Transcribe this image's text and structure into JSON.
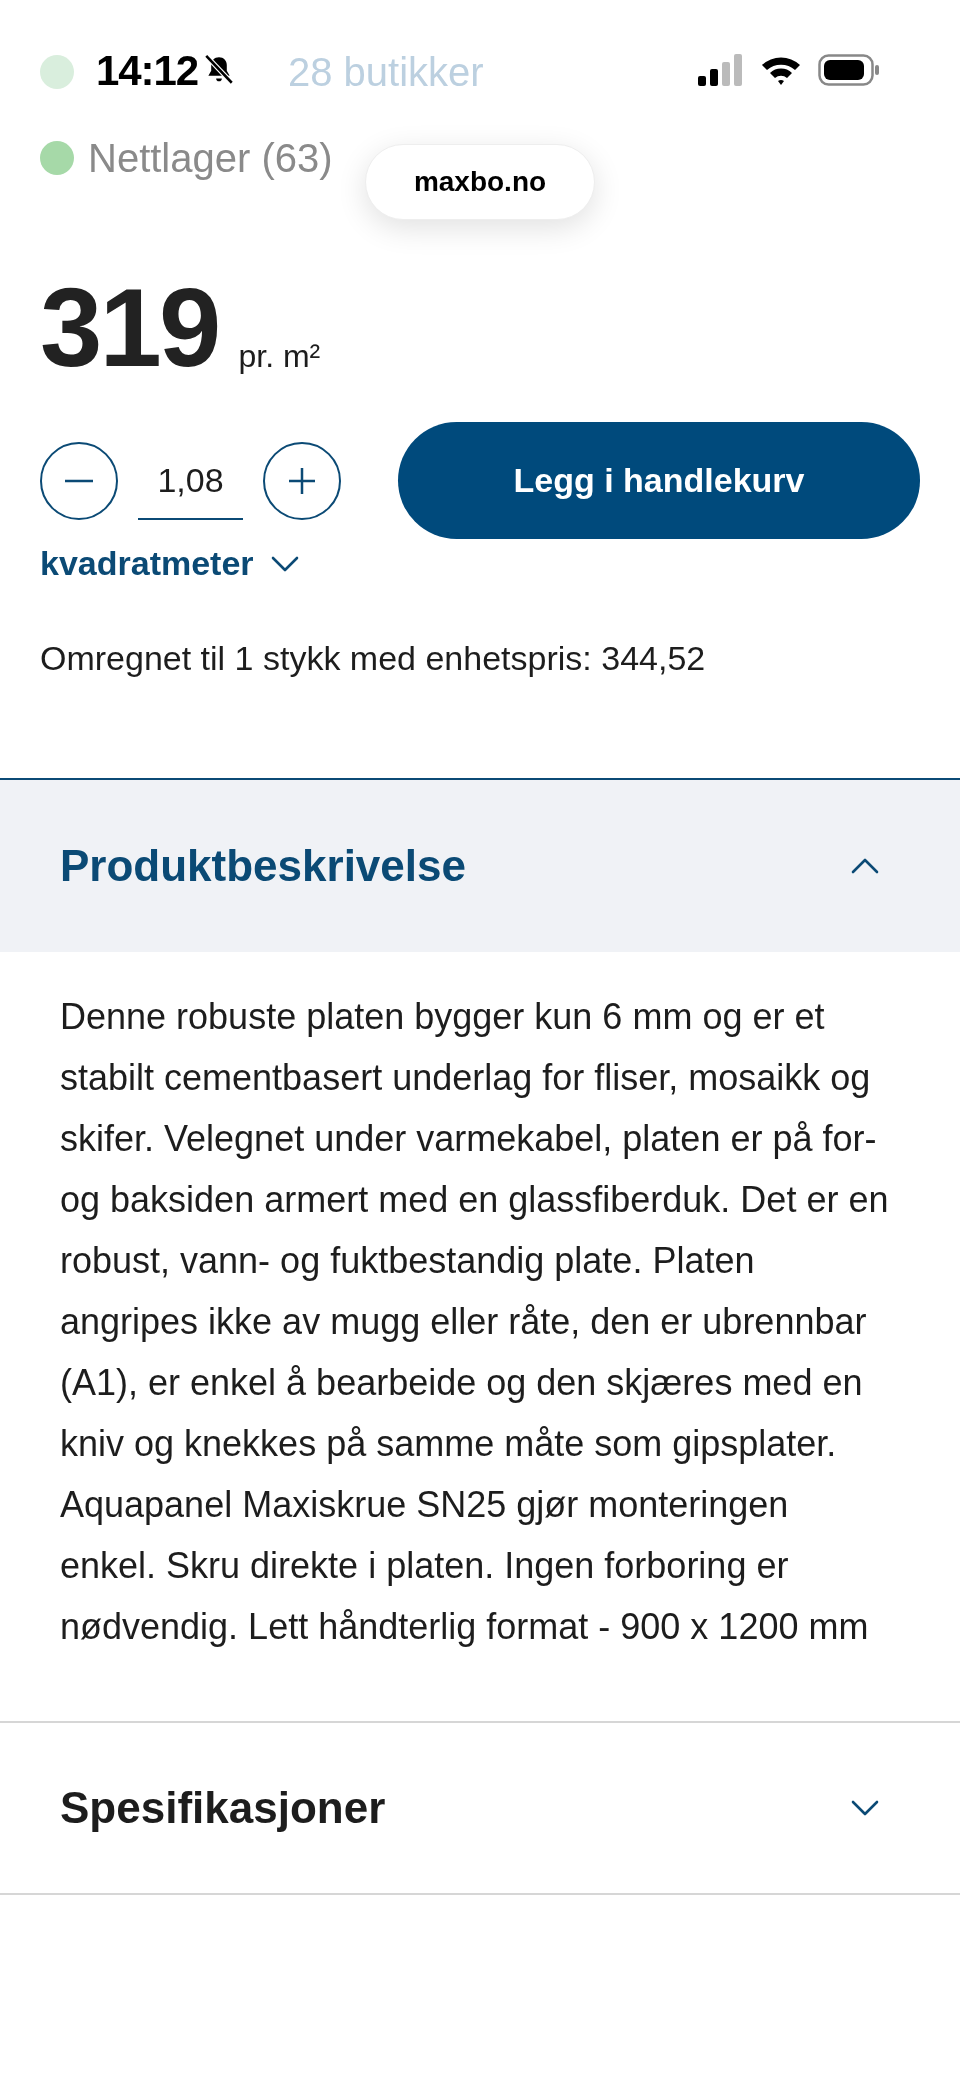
{
  "status_bar": {
    "time": "14:12",
    "silent": true
  },
  "stock": [
    {
      "label": "28 butikker",
      "color": "#d9eedd"
    },
    {
      "label": "Nettlager (63)",
      "color": "#a6d9a8"
    }
  ],
  "url_pill": "maxbo.no",
  "price": {
    "amount": "319",
    "unit": "pr. m²"
  },
  "quantity": {
    "value": "1,08",
    "unit": "kvadratmeter"
  },
  "add_to_cart": "Legg i handlekurv",
  "unit_price_note": "Omregnet til 1 stykk med enhetspris: 344,52",
  "sections": [
    {
      "title": "Produktbeskrivelse",
      "expanded": true,
      "body": "Denne robuste platen bygger kun 6 mm og er et stabilt cementbasert underlag for fliser, mosaikk og skifer. Velegnet under varmekabel, platen er på for- og baksiden armert med en glassfiberduk. Det er en robust, vann- og fuktbestandig plate. Platen angripes ikke av mugg eller råte, den er ubrennbar (A1), er enkel å bearbeide og den skjæres med en kniv og knekkes på samme måte som gipsplater. Aquapanel Maxiskrue SN25 gjør monteringen enkel. Skru direkte i platen. Ingen forboring er nødvendig. Lett håndterlig format - 900 x 1200 mm"
    },
    {
      "title": "Spesifikasjoner",
      "expanded": false
    }
  ]
}
